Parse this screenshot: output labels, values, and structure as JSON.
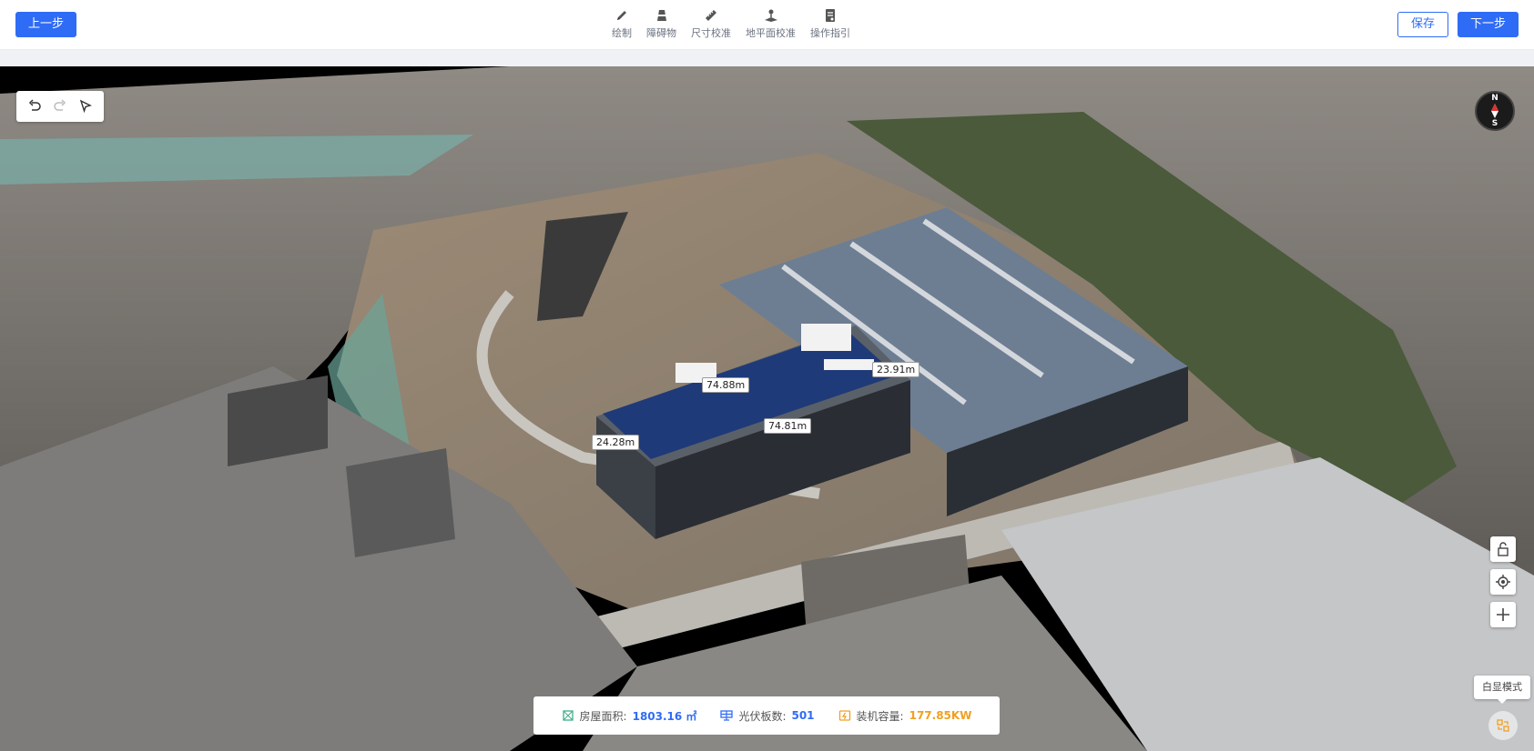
{
  "toolbar": {
    "prev_label": "上一步",
    "save_label": "保存",
    "next_label": "下一步",
    "tools": [
      {
        "label": "绘制",
        "icon": "pencil-icon"
      },
      {
        "label": "障碍物",
        "icon": "obstacle-icon"
      },
      {
        "label": "尺寸校准",
        "icon": "ruler-icon"
      },
      {
        "label": "地平面校准",
        "icon": "ground-plane-icon"
      },
      {
        "label": "操作指引",
        "icon": "guide-icon"
      }
    ]
  },
  "viewport": {
    "compass": {
      "n": "N",
      "s": "S"
    },
    "dimensions": [
      "74.88m",
      "23.91m",
      "74.81m",
      "24.28m"
    ],
    "mode_tooltip": "白显模式"
  },
  "stats": {
    "area_label": "房屋面积:",
    "area_value": "1803.16 ㎡",
    "panels_label": "光伏板数:",
    "panels_value": "501",
    "capacity_label": "装机容量:",
    "capacity_value": "177.85KW"
  },
  "colors": {
    "primary": "#2f6cf6",
    "capacity": "#f0a020",
    "panel": "#1f3a78"
  }
}
